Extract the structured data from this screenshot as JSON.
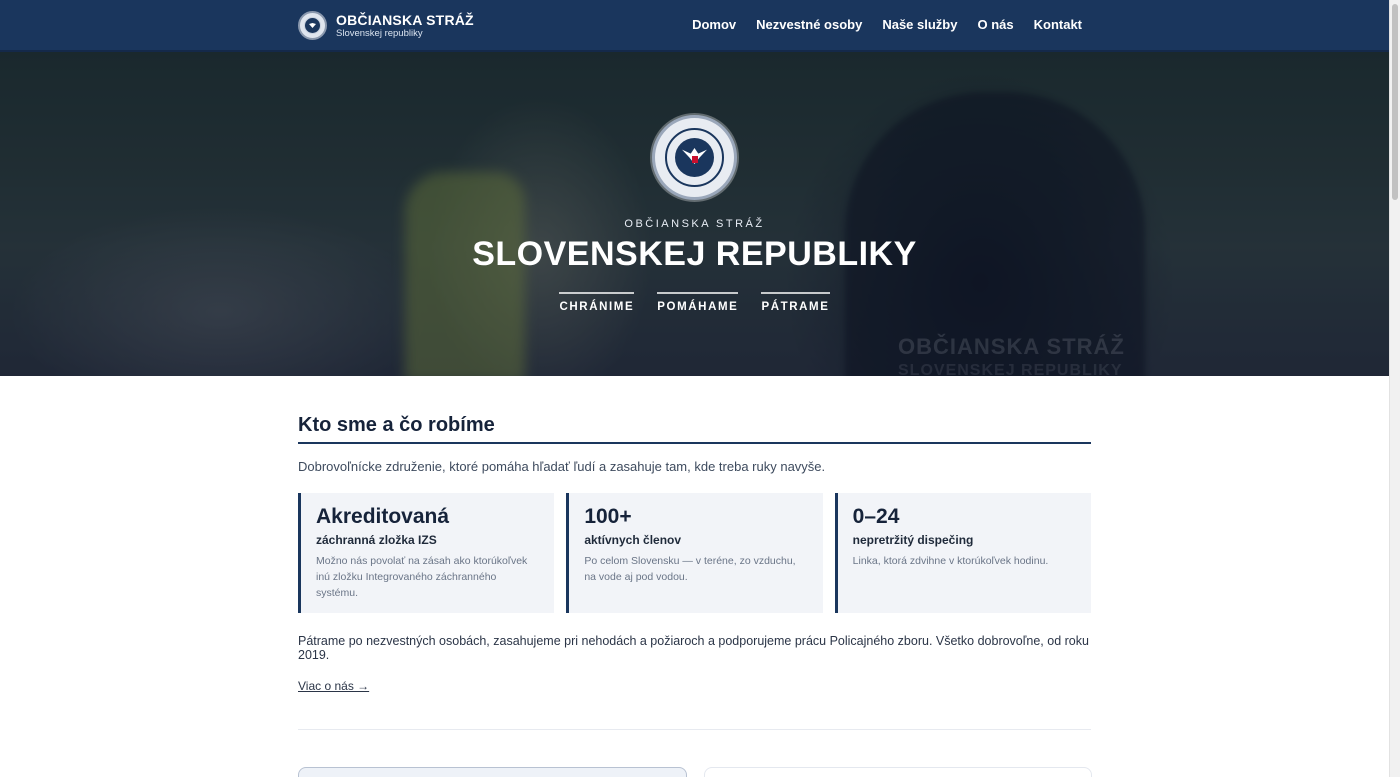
{
  "header": {
    "brand_title": "OBČIANSKA STRÁŽ",
    "brand_subtitle": "Slovenskej republiky",
    "nav": [
      "Domov",
      "Nezvestné osoby",
      "Naše služby",
      "O nás",
      "Kontakt"
    ]
  },
  "hero": {
    "kicker": "OBČIANSKA STRÁŽ",
    "title": "SLOVENSKEJ REPUBLIKY",
    "tags": [
      "CHRÁNIME",
      "POMÁHAME",
      "PÁTRAME"
    ],
    "watermark": [
      "OBČIANSKA STRÁŽ",
      "SLOVENSKEJ REPUBLIKY"
    ]
  },
  "about": {
    "title": "Kto sme a čo robíme",
    "lead": "Dobrovoľnícke združenie, ktoré pomáha hľadať ľudí a zasahuje tam, kde treba ruky navyše.",
    "cards": [
      {
        "big": "Akreditovaná",
        "sub": "záchranná zložka IZS",
        "desc": "Možno nás povolať na zásah ako ktorúkoľvek inú zložku Integrovaného záchranného systému."
      },
      {
        "big": "100+",
        "sub": "aktívnych členov",
        "desc": "Po celom Slovensku — v teréne, zo vzduchu, na vode aj pod vodou."
      },
      {
        "big": "0–24",
        "sub": "nepretržitý dispečing",
        "desc": "Linka, ktorá zdvihne v ktorúkoľvek hodinu."
      }
    ],
    "paragraph": "Pátrame po nezvestných osobách, zasahujeme pri nehodách a požiaroch a podporujeme prácu Policajného zboru. Všetko dobrovoľne, od roku 2019.",
    "more_link": "Viac o nás →"
  },
  "colors": {
    "header_bg": "#1a365d",
    "accent": "#1a365d",
    "card_bg": "#f2f4f8"
  }
}
